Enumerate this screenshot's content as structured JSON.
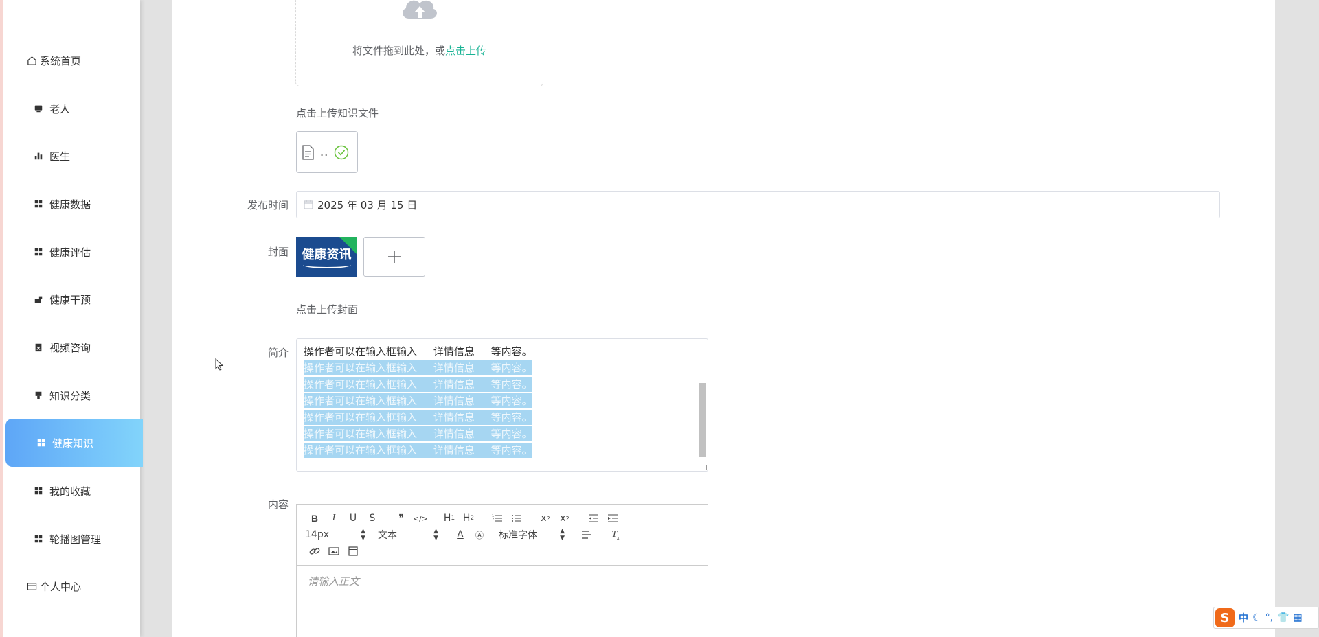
{
  "sidebar": {
    "items": [
      {
        "label": "系统首页",
        "icon": "home-icon"
      },
      {
        "label": "老人",
        "icon": "monitor-icon"
      },
      {
        "label": "医生",
        "icon": "bar-chart-icon"
      },
      {
        "label": "健康数据",
        "icon": "grid-icon"
      },
      {
        "label": "健康评估",
        "icon": "grid-icon"
      },
      {
        "label": "健康干预",
        "icon": "hand-icon"
      },
      {
        "label": "视频咨询",
        "icon": "calendar-x-icon"
      },
      {
        "label": "知识分类",
        "icon": "tag-icon"
      },
      {
        "label": "健康知识",
        "icon": "grid-icon",
        "active": true
      },
      {
        "label": "我的收藏",
        "icon": "grid-icon"
      },
      {
        "label": "轮播图管理",
        "icon": "grid-icon"
      },
      {
        "label": "个人中心",
        "icon": "id-card-icon"
      }
    ]
  },
  "upload": {
    "drag_text": "将文件拖到此处，或",
    "drag_link": "点击上传",
    "tip": "点击上传知识文件",
    "file_name": ".."
  },
  "form": {
    "publish_time_label": "发布时间",
    "publish_time_value": "2025 年 03 月 15 日",
    "cover_label": "封面",
    "cover_image_text": "健康资讯",
    "cover_tip": "点击上传封面",
    "intro_label": "简介",
    "intro_lines": [
      "操作者可以在输入框输入     详情信息     等内容。",
      "操作者可以在输入框输入     详情信息     等内容。",
      "操作者可以在输入框输入     详情信息     等内容。",
      "操作者可以在输入框输入     详情信息     等内容。",
      "操作者可以在输入框输入     详情信息     等内容。",
      "操作者可以在输入框输入     详情信息     等内容。",
      "操作者可以在输入框输入     详情信息     等内容。"
    ],
    "content_label": "内容"
  },
  "editor": {
    "font_size": "14px",
    "header_select": "文本",
    "font_family": "标准字体",
    "placeholder": "请输入正文"
  },
  "ime": {
    "logo": "S",
    "mode": "中"
  }
}
